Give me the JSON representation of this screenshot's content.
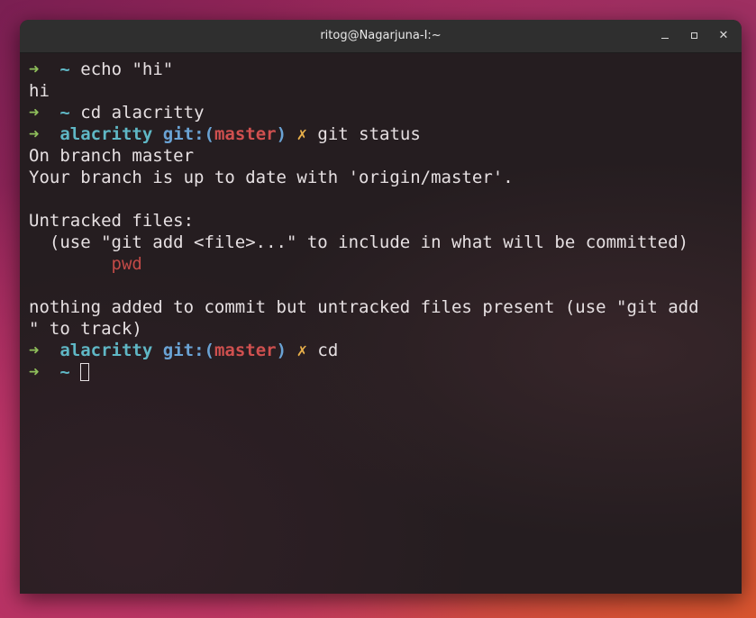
{
  "window": {
    "title": "ritog@Nagarjuna-I:~",
    "controls": {
      "minimize": "minimize-icon",
      "maximize": "maximize-icon",
      "close": "✕"
    }
  },
  "prompt": {
    "arrow": "➜",
    "home": "~",
    "dir": "alacritty",
    "git_open": "git:(",
    "branch": "master",
    "git_close": ")",
    "dirty": "✗"
  },
  "commands": {
    "c1": "echo \"hi\"",
    "c2": "cd alacritty",
    "c3": "git status",
    "c4": "cd"
  },
  "output": {
    "o1": "hi",
    "o2": "On branch master",
    "o3": "Your branch is up to date with 'origin/master'.",
    "o4": "Untracked files:",
    "o5": "  (use \"git add <file>...\" to include in what will be committed)",
    "o6_indent": "        ",
    "o6_file": "pwd",
    "o7": "nothing added to commit but untracked files present (use \"git add",
    "o8": "\" to track)"
  },
  "colors": {
    "arrow": "#8fbf5b",
    "dir": "#5fb7c5",
    "git": "#6aa3d5",
    "branch": "#d0504f",
    "dirty": "#e9b04a",
    "untracked": "#c24a47"
  }
}
